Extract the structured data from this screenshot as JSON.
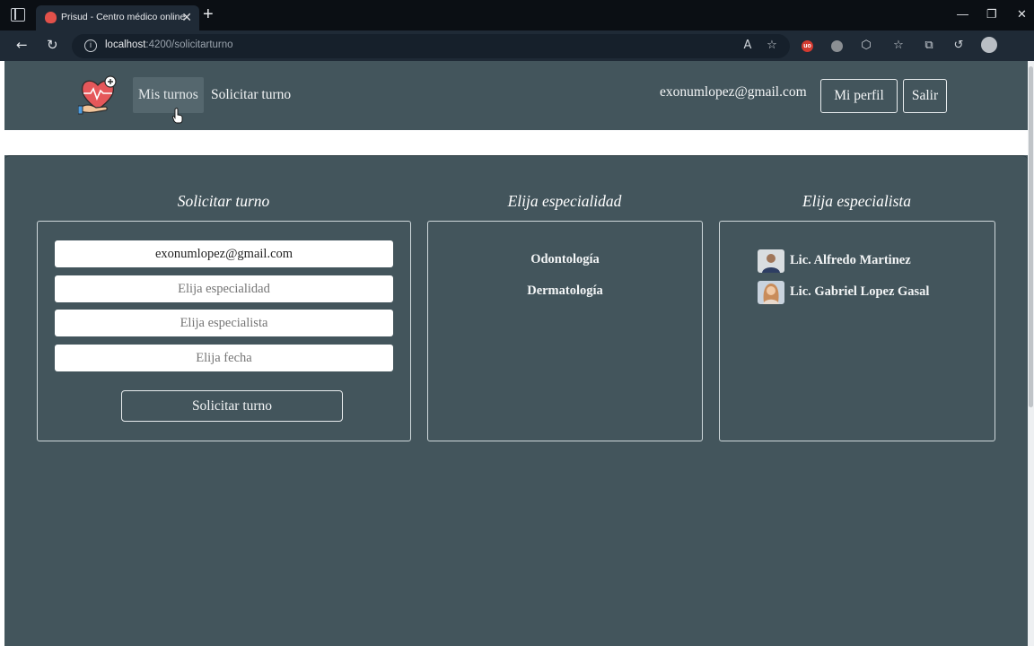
{
  "browser": {
    "tab_title": "Prisud - Centro médico online",
    "tab_close": "✕",
    "new_tab": "+",
    "url_host": "localhost",
    "url_path": ":4200/solicitarturno",
    "window_controls": {
      "minimize": "—",
      "maximize": "❐",
      "close": "✕"
    },
    "more": "···"
  },
  "navbar": {
    "links": [
      "Mis turnos",
      "Solicitar turno"
    ],
    "user_email": "exonumlopez@gmail.com",
    "profile_button": "Mi perfil",
    "logout_button": "Salir"
  },
  "form": {
    "title": "Solicitar turno",
    "email_value": "exonumlopez@gmail.com",
    "specialty_placeholder": "Elija especialidad",
    "specialist_placeholder": "Elija especialista",
    "date_placeholder": "Elija fecha",
    "submit_label": "Solicitar turno"
  },
  "specialties": {
    "title": "Elija especialidad",
    "items": [
      "Odontología",
      "Dermatología"
    ]
  },
  "specialists": {
    "title": "Elija especialista",
    "items": [
      "Lic. Alfredo Martinez",
      "Lic. Gabriel Lopez Gasal"
    ]
  },
  "colors": {
    "page_bg": "#43555c",
    "chrome_bg": "#1f2a36",
    "tabbar_bg": "#0b0f14",
    "accent": "#4e8fd9"
  }
}
